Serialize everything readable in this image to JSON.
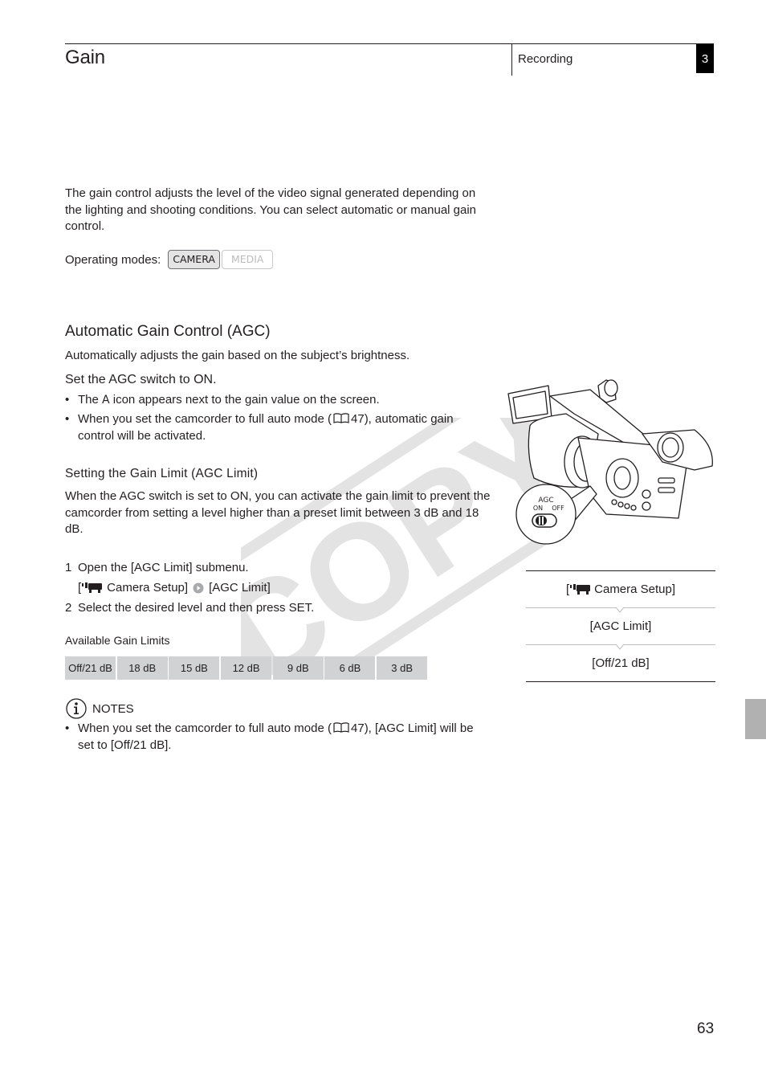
{
  "header": {
    "page_title": "Gain",
    "chapter_name": "Recording",
    "chapter_number": "3"
  },
  "intro": {
    "text": "The gain control adjusts the level of the video signal generated depending on the lighting and shooting conditions. You can select automatic or manual gain control.",
    "operating_modes_label": "Operating modes:",
    "modes": [
      {
        "label": "CAMERA",
        "active": true
      },
      {
        "label": "MEDIA",
        "active": false
      }
    ]
  },
  "agc": {
    "heading": "Automatic Gain Control (AGC)",
    "subtitle": "Automatically adjusts the gain based on the subject’s brightness.",
    "step_heading": "Set the AGC switch to ON.",
    "bullets": [
      {
        "pre": "The ",
        "bold": "A",
        "post": " icon appears next to the gain value on the screen."
      },
      {
        "pre": "When you set the camcorder to full auto mode (",
        "ref": "47",
        "post": "), automatic gain control will be activated."
      }
    ]
  },
  "agc_limit": {
    "heading": "Setting the Gain Limit (AGC Limit)",
    "text": "When the AGC switch is set to ON, you can activate the gain limit to prevent the camcorder from setting a level higher than a preset limit between 3 dB and 18 dB.",
    "steps": [
      {
        "num": "1",
        "text": "Open the [AGC Limit] submenu."
      },
      {
        "num": "2",
        "text": "Select the desired level and then press SET."
      }
    ],
    "menu_path": {
      "open_bracket": "[",
      "menu": "Camera Setup]",
      "submenu": "[AGC Limit]"
    },
    "table_title": "Available Gain Limits",
    "gain_limits": [
      "Off/21 dB",
      "18 dB",
      "15 dB",
      "12 dB",
      "9 dB",
      "6 dB",
      "3 dB"
    ]
  },
  "notes": {
    "heading": "NOTES",
    "items": [
      {
        "pre": "When you set the camcorder to full auto mode (",
        "ref": "47",
        "post": "), [AGC Limit] will be set to [Off/21 dB]."
      }
    ]
  },
  "illustration": {
    "switch_label": "AGC",
    "on_label": "ON",
    "off_label": "OFF"
  },
  "menu_box": {
    "items": [
      "Camera Setup]",
      "[AGC Limit]",
      "[Off/21 dB]"
    ],
    "first_prefix": "["
  },
  "watermark": "COPY",
  "page_number": "63",
  "colors": {
    "text": "#231f20",
    "table_cell": "#d0d2d3",
    "side_tab": "#b1b1b1",
    "watermark": "#e6e6e6"
  }
}
